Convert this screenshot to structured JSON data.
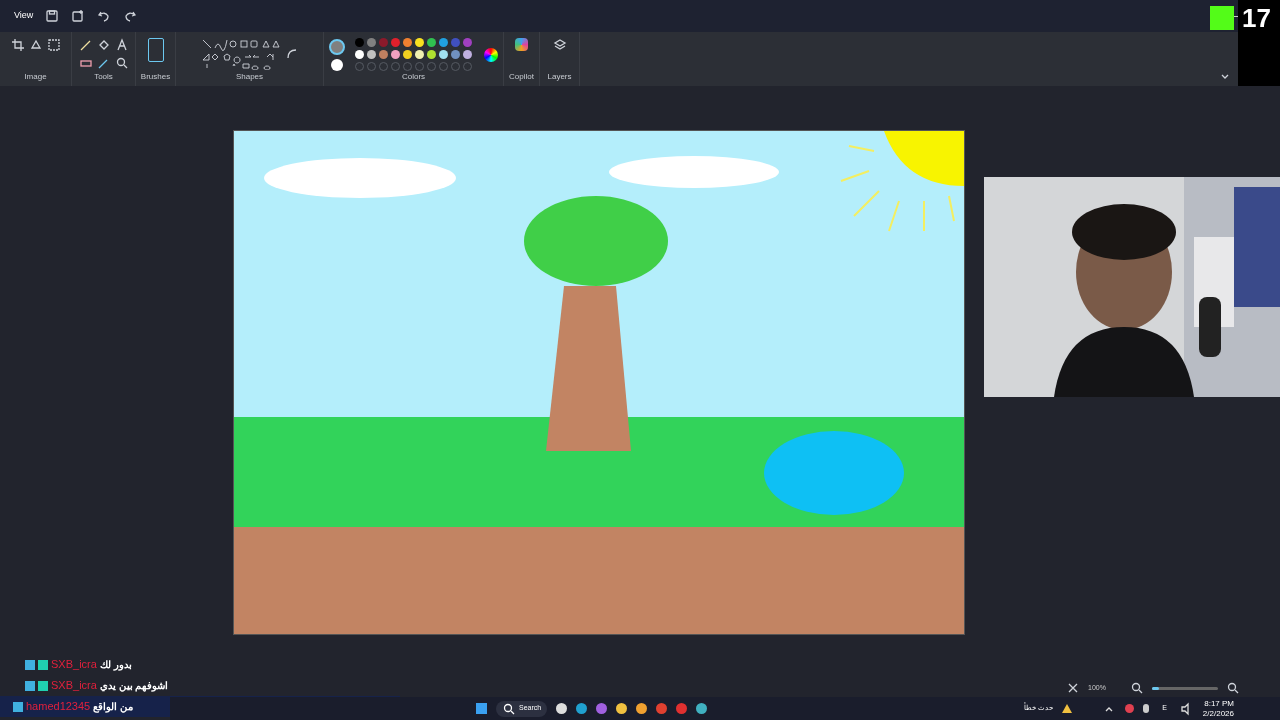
{
  "menu": [
    "View"
  ],
  "ribbon_groups": [
    "Image",
    "Tools",
    "Brushes",
    "Shapes",
    "Colors",
    "Copilot",
    "Layers"
  ],
  "colors": {
    "primary": {
      "color": "#808080"
    },
    "secondary": {
      "color": "#ffffff"
    },
    "palette": [
      {
        "color": "#000000"
      },
      {
        "color": "#808080"
      },
      {
        "color": "#8b1a2b"
      },
      {
        "color": "#e0202c"
      },
      {
        "color": "#f08030"
      },
      {
        "color": "#f8e020"
      },
      {
        "color": "#30c050"
      },
      {
        "color": "#20a0e0"
      },
      {
        "color": "#4050c0"
      },
      {
        "color": "#a040c0"
      },
      {
        "color": "#ffffff"
      },
      {
        "color": "#c0c0c0"
      },
      {
        "color": "#c08060"
      },
      {
        "color": "#f0a0c0"
      },
      {
        "color": "#f0d020"
      },
      {
        "color": "#f0f0b0"
      },
      {
        "color": "#b0e030"
      },
      {
        "color": "#a0e0f0"
      },
      {
        "color": "#7090c0"
      },
      {
        "color": "#c0b0e0"
      }
    ]
  },
  "stream_overlay": {
    "viewer_count": "17"
  },
  "webcam": {
    "kind": "picture"
  },
  "chat": [
    {
      "user": "SXB_icra",
      "color": "#e0203c",
      "badges": [
        {
          "kind": "moderator"
        },
        {
          "kind": "gift"
        }
      ],
      "text": "بدور لك"
    },
    {
      "user": "SXB_icra",
      "color": "#e0203c",
      "badges": [
        {
          "kind": "moderator"
        },
        {
          "kind": "gift"
        }
      ],
      "text": "اشوفهم بين يدي"
    },
    {
      "user": "hamed12345",
      "color": "#e0203c",
      "badges": [
        {
          "kind": "moderator"
        }
      ],
      "text": "من الواقع"
    }
  ],
  "zoom": {
    "value": "100%",
    "level": 0.1
  },
  "taskbar": {
    "search": "Search",
    "tray_alert": "حدث خطأ",
    "language": "E",
    "time": "8:17 PM",
    "date": "2/2/2026"
  }
}
